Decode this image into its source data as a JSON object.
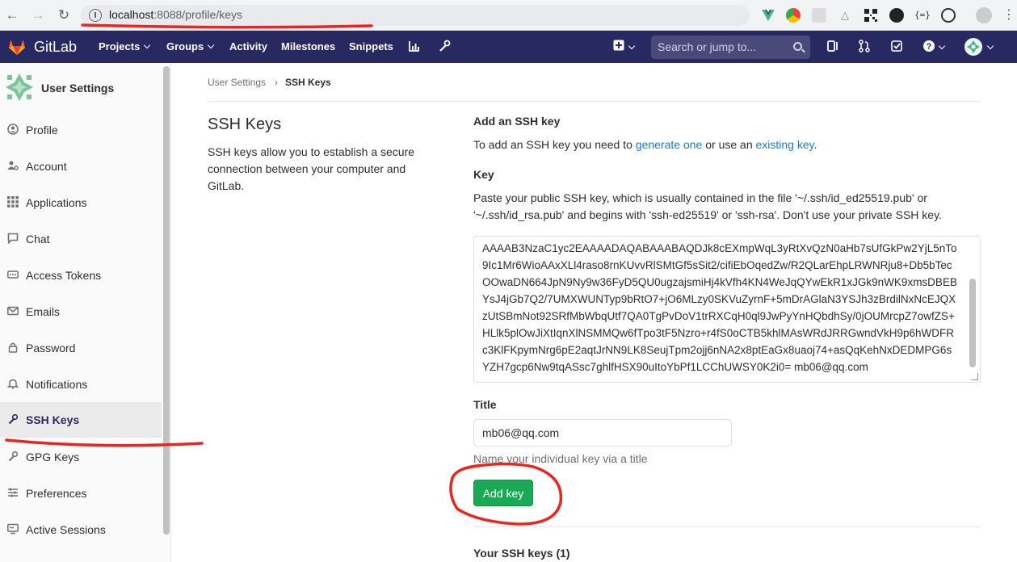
{
  "browser": {
    "url_host": "localhost",
    "url_rest": ":8088/profile/keys"
  },
  "header": {
    "brand": "GitLab",
    "nav": [
      "Projects",
      "Groups",
      "Activity",
      "Milestones",
      "Snippets"
    ],
    "search_placeholder": "Search or jump to..."
  },
  "sidebar": {
    "title": "User Settings",
    "items": [
      {
        "label": "Profile",
        "icon": "profile-icon"
      },
      {
        "label": "Account",
        "icon": "account-icon"
      },
      {
        "label": "Applications",
        "icon": "applications-icon"
      },
      {
        "label": "Chat",
        "icon": "chat-icon"
      },
      {
        "label": "Access Tokens",
        "icon": "access-tokens-icon"
      },
      {
        "label": "Emails",
        "icon": "email-icon"
      },
      {
        "label": "Password",
        "icon": "lock-icon"
      },
      {
        "label": "Notifications",
        "icon": "bell-icon"
      },
      {
        "label": "SSH Keys",
        "icon": "key-icon",
        "active": true
      },
      {
        "label": "GPG Keys",
        "icon": "key-icon"
      },
      {
        "label": "Preferences",
        "icon": "preferences-icon"
      },
      {
        "label": "Active Sessions",
        "icon": "sessions-icon"
      }
    ]
  },
  "breadcrumb": {
    "parent": "User Settings",
    "current": "SSH Keys"
  },
  "intro": {
    "title": "SSH Keys",
    "description": "SSH keys allow you to establish a secure connection between your computer and GitLab."
  },
  "form": {
    "heading": "Add an SSH key",
    "help_prefix": "To add an SSH key you need to ",
    "help_link1": "generate one",
    "help_mid": " or use an ",
    "help_link2": "existing key",
    "help_suffix": ".",
    "key_label": "Key",
    "key_help": "Paste your public SSH key, which is usually contained in the file '~/.ssh/id_ed25519.pub' or '~/.ssh/id_rsa.pub' and begins with 'ssh-ed25519' or 'ssh-rsa'. Don't use your private SSH key.",
    "key_value": "AAAAB3NzaC1yc2EAAAADAQABAAABAQDJk8cEXmpWqL3yRtXvQzN0aHb7sUfGkPw2YjL5nTo9Ic1Mr6WioAAxXLl4raso8rnKUvvRlSMtGf5sSit2/cifiEbOqedZw/R2QLarEhpLRWNRju8+Db5bTecOOwaDN664JpN9Ny9w36FyD5QU0ugzajsmiHj4kVfh4KN4WeJqQYwEkR1xJGk9nWK9xmsDBEBYsJ4jGb7Q2/7UMXWUNTyp9bRtO7+jO6MLzy0SKVuZyrnF+5mDrAGlaN3YSJh3zBrdilNxNcEJQXzUtSBmNot92SRfMbWbqUtf7QA0TgPvDoV1trRXCqH0ql9JwPyYnHQbdhSy/0jOUMrcpZ7owfZS+HLlk5plOwJiXtIqnXlNSMMQw6fTpo3tF5Nzro+r4fS0oCTB5khlMAsWRdJRRGwndVkH9p6hWDFRc3KlFKpymNrg6pE2aqtJrNN9LK8SeujTpm2ojj6nNA2x8ptEaGx8uaoj74+asQqKehNxDEDMPG6sYZH7gcp6Nw9tqASsc7ghlfHSX90uItoYbPf1LCChUWSY0K2i0= mb06@qq.com",
    "title_label": "Title",
    "title_value": "mb06@qq.com",
    "title_help": "Name your individual key via a title",
    "add_button": "Add key",
    "your_keys": "Your SSH keys (1)"
  },
  "colors": {
    "header_bg": "#292961",
    "link": "#1f78d1",
    "button_green": "#1aaa55",
    "annotation_red": "#e8251f"
  }
}
